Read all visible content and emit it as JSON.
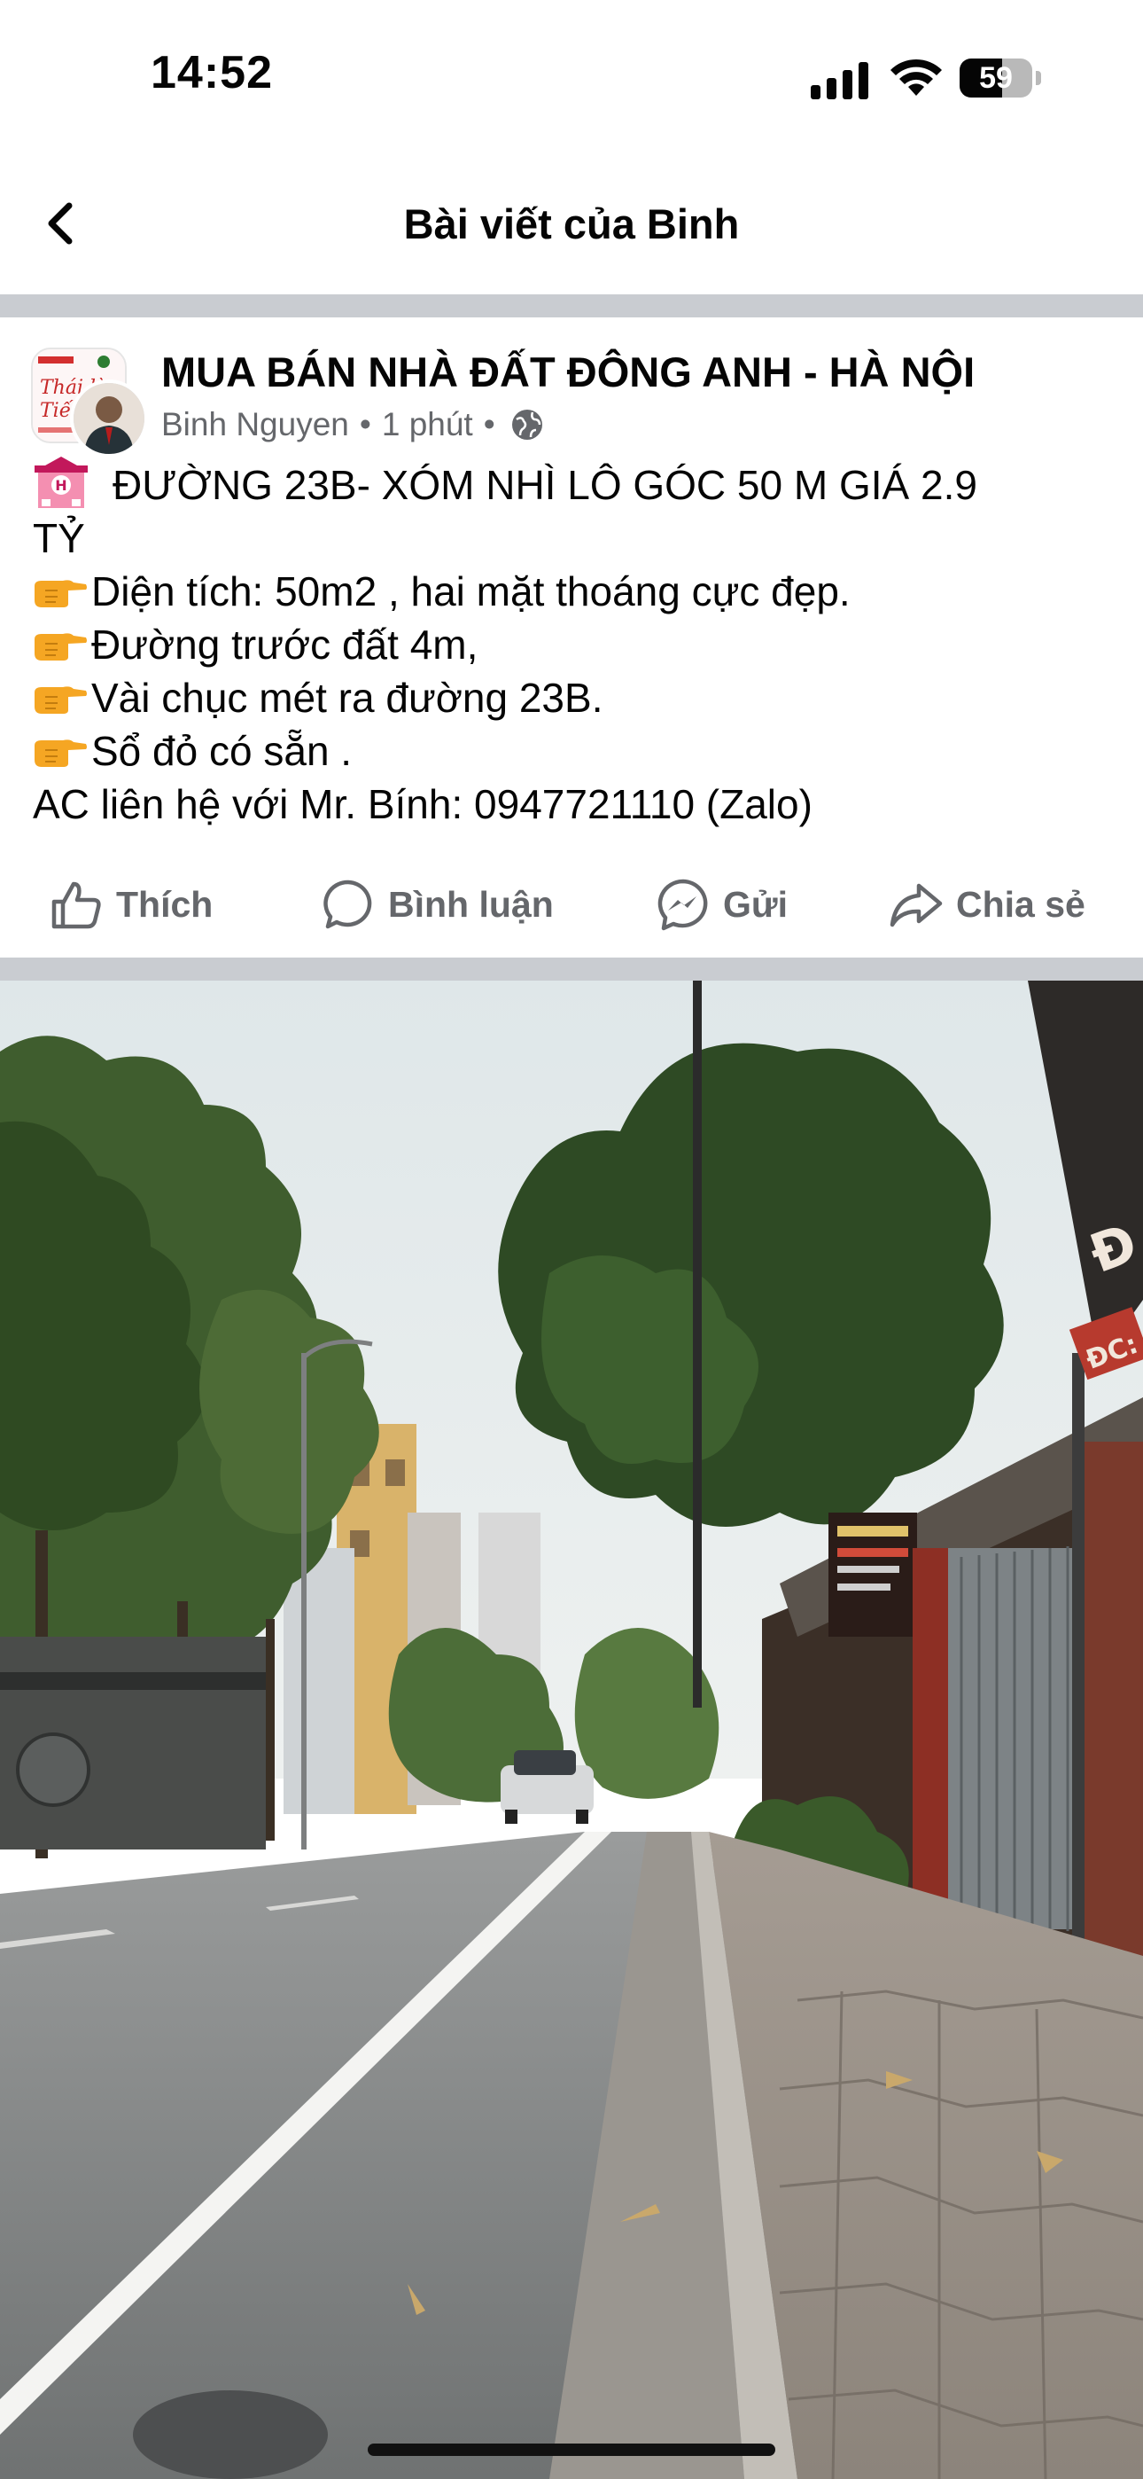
{
  "status_bar": {
    "time": "14:52",
    "battery_level": "59",
    "battery_fraction": 0.59,
    "icons": [
      "cellular-signal-icon",
      "wifi-icon",
      "battery-icon"
    ]
  },
  "nav": {
    "title": "Bài viết của Binh",
    "back_icon": "chevron-left-icon"
  },
  "post": {
    "group_name": "MUA BÁN NHÀ ĐẤT ĐÔNG ANH - HÀ NỘI",
    "author": "Binh Nguyen",
    "time_ago": "1 phút",
    "separator": "•",
    "privacy_icon": "globe-icon",
    "lines": [
      "ĐƯỜNG 23B-  XÓM NHÌ LÔ GÓC 50 M GIÁ 2.9",
      "TỶ",
      "Diện tích: 50m2 , hai mặt thoáng cực đẹp.",
      "Đường trước đất 4m,",
      "Vài chục mét ra đường 23B.",
      "Sổ đỏ có sẵn .",
      "AC liên hệ với Mr. Bính: 0947721110 (Zalo)"
    ],
    "line_icons": [
      "hotel-icon",
      "",
      "pointing-hand-icon",
      "pointing-hand-icon",
      "pointing-hand-icon",
      "pointing-hand-icon",
      ""
    ]
  },
  "actions": {
    "like": "Thích",
    "comment": "Bình luận",
    "send": "Gửi",
    "share": "Chia sẻ"
  },
  "photo": {
    "sign_text": "ĐC:"
  },
  "colors": {
    "text_primary": "#050505",
    "text_secondary": "#65676b",
    "separator": "#c9ccd1"
  }
}
